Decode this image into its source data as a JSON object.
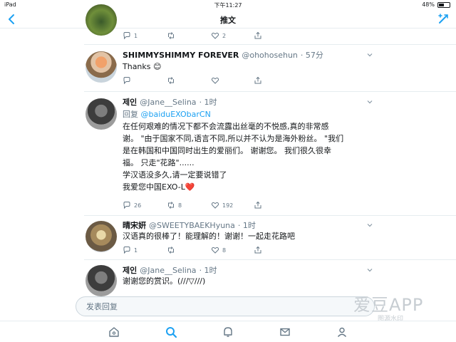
{
  "status_bar": {
    "device": "iPad",
    "time": "下午11:27",
    "battery": "48%"
  },
  "nav": {
    "title": "推文"
  },
  "tweets": [
    {
      "counts": {
        "reply": "1",
        "retweet": "",
        "like": "2"
      }
    },
    {
      "name": "SHIMMYSHIMMY FOREVER",
      "handle": "@ohohosehun",
      "time": "· 57分",
      "text": "Thanks 😊",
      "counts": {
        "reply": "",
        "retweet": "",
        "like": ""
      }
    },
    {
      "name": "제인",
      "handle": "@Jane__Selina",
      "time": "· 1时",
      "reply_prefix": "回复 ",
      "reply_mention": "@baiduEXObarCN",
      "lines": [
        "在任何艰难的情况下都不会流露出丝毫的不悦感,真的非常感",
        "谢。 \"由于国家不同,语言不同,所以并不认为是海外粉丝。 \"我们",
        "是在韩国和中国同时出生的爱丽们。 谢谢您。 我们很久很幸",
        "福。 只走\"花路\"......",
        "学汉语没多久,请一定要说错了",
        "我爱您中国EXO-L❤️"
      ],
      "counts": {
        "reply": "26",
        "retweet": "8",
        "like": "192"
      }
    },
    {
      "name": "晴宋姸",
      "handle": "@SWEETYBAEKHyuna",
      "time": "· 1时",
      "text": "汉语真的很棒了！能理解的！谢谢！一起走花路吧",
      "counts": {
        "reply": "1",
        "retweet": "",
        "like": "8"
      }
    },
    {
      "name": "제인",
      "handle": "@Jane__Selina",
      "time": "· 1时",
      "text": "谢谢您的赏识。(///▽///)",
      "counts": {
        "reply": "",
        "retweet": "",
        "like": ""
      }
    }
  ],
  "reply_box": {
    "placeholder": "发表回复"
  },
  "watermark": {
    "main": "爱豆APP",
    "sub": "图源水印"
  },
  "colors": {
    "accent": "#1da1f2",
    "secondary_text": "#657786",
    "divider": "#e6ecf0",
    "heart": "#e0245e"
  },
  "icons": [
    "back-chevron-icon",
    "compose-tweet-icon",
    "reply-icon",
    "retweet-icon",
    "like-icon",
    "share-icon",
    "home-icon",
    "search-icon",
    "notifications-icon",
    "messages-icon",
    "profile-icon"
  ]
}
